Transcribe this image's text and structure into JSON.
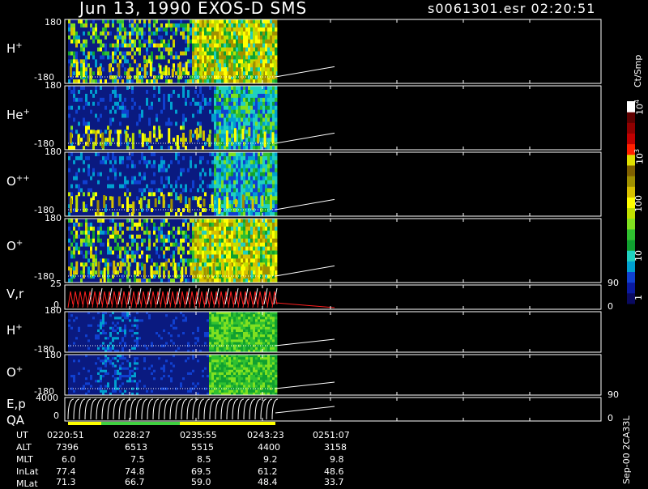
{
  "header": {
    "left_title": "Jun 13, 1990   EXOS-D SMS",
    "right_title": "s0061301.esr  02:20:51"
  },
  "panels": [
    {
      "id": "hplus",
      "label": "H",
      "sup": "+",
      "top_tick": "180",
      "bottom_tick": "-180"
    },
    {
      "id": "heplus",
      "label": "He",
      "sup": "+",
      "top_tick": "180",
      "bottom_tick": "-180"
    },
    {
      "id": "oplusplus",
      "label": "O",
      "sup": "++",
      "top_tick": "180",
      "bottom_tick": "-180"
    },
    {
      "id": "oplus",
      "label": "O",
      "sup": "+",
      "top_tick": "180",
      "bottom_tick": "-180"
    },
    {
      "id": "vr",
      "label": "V,r",
      "sup": "",
      "top_tick": "25",
      "bottom_tick": "0",
      "right_top": "90",
      "right_bottom": "0"
    },
    {
      "id": "hplus2",
      "label": "H",
      "sup": "+",
      "top_tick": "180",
      "bottom_tick": "-180"
    },
    {
      "id": "oplus2",
      "label": "O",
      "sup": "+",
      "top_tick": "180",
      "bottom_tick": "-180"
    },
    {
      "id": "ep",
      "label": "E,p",
      "label2": "QA",
      "sup": "",
      "top_tick": "4000",
      "bottom_tick": "0",
      "right_top": "90",
      "right_bottom": "0"
    }
  ],
  "colorbar": {
    "unit": "Ct/Smp",
    "ticks": [
      {
        "label": "1",
        "value": 1
      },
      {
        "label": "10",
        "value": 10
      },
      {
        "label": "100",
        "value": 100
      },
      {
        "label": "10",
        "sup": "3",
        "value": 1000
      },
      {
        "label": "10",
        "sup": "4",
        "value": 10000
      }
    ],
    "colors": [
      "#0a0a60",
      "#0a1aa0",
      "#1040d0",
      "#00a0d0",
      "#20d0c0",
      "#10a030",
      "#30c030",
      "#80e020",
      "#c0e000",
      "#ffff00",
      "#d8c000",
      "#a09000",
      "#806000",
      "#e0e000",
      "#ff2000",
      "#c00000",
      "#900000",
      "#600000",
      "#ffffff"
    ]
  },
  "footer": {
    "row_labels": [
      "UT",
      "ALT",
      "MLT",
      "InLat",
      "MLat"
    ],
    "columns": [
      {
        "UT": "0220:51",
        "ALT": "7396",
        "MLT": "6.0",
        "InLat": "77.4",
        "MLat": "71.3"
      },
      {
        "UT": "0228:27",
        "ALT": "6513",
        "MLT": "7.5",
        "InLat": "74.8",
        "MLat": "66.7"
      },
      {
        "UT": "0235:55",
        "ALT": "5515",
        "MLT": "8.5",
        "InLat": "69.5",
        "MLat": "59.0"
      },
      {
        "UT": "0243:23",
        "ALT": "4400",
        "MLT": "9.2",
        "InLat": "61.2",
        "MLat": "48.4"
      },
      {
        "UT": "0251:07",
        "ALT": "3158",
        "MLT": "9.8",
        "InLat": "48.6",
        "MLat": "33.7"
      }
    ],
    "side_text": "Sep-00 2CA33L"
  },
  "chart_data": {
    "type": "heatmap",
    "title": "Jun 13, 1990   EXOS-D SMS",
    "x_axis": "UT",
    "x_ticks": [
      "0220:51",
      "0228:27",
      "0235:55",
      "0243:23",
      "0251:07"
    ],
    "data_extent_fraction_of_time_axis": 0.79,
    "series": [
      {
        "name": "H+",
        "ylim": [
          -180,
          180
        ]
      },
      {
        "name": "He+",
        "ylim": [
          -180,
          180
        ]
      },
      {
        "name": "O++",
        "ylim": [
          -180,
          180
        ]
      },
      {
        "name": "O+",
        "ylim": [
          -180,
          180
        ]
      },
      {
        "name": "V,r",
        "ylim": [
          0,
          25
        ]
      },
      {
        "name": "H+",
        "ylim": [
          -180,
          180
        ]
      },
      {
        "name": "O+",
        "ylim": [
          -180,
          180
        ]
      },
      {
        "name": "E,p",
        "ylim": [
          0,
          4000
        ]
      }
    ],
    "colorbar_range": [
      1,
      10000
    ],
    "colorbar_scale": "log",
    "colorbar_unit": "Ct/Smp",
    "qa_bar_segments": [
      {
        "from": "0220:51",
        "color": "#ffff00"
      },
      {
        "from": "0223:00",
        "color": "#40d040"
      },
      {
        "from": "0235:55",
        "color": "#ffff00"
      }
    ]
  }
}
